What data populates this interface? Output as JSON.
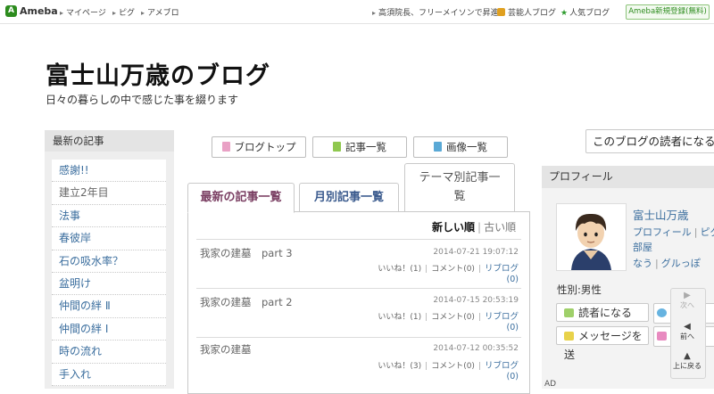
{
  "topbar": {
    "logo": "Ameba",
    "links": [
      "マイページ",
      "ピグ",
      "アメブロ"
    ],
    "news": "高須院長、フリーメイソンで昇進",
    "geinou": "芸能人ブログ",
    "ninki": "人気ブログ",
    "register": "Ameba新規登録(無料)"
  },
  "blog": {
    "title": "富士山万歳のブログ",
    "description": "日々の暮らしの中で感じた事を綴ります"
  },
  "sidebar": {
    "heading": "最新の記事",
    "items": [
      {
        "label": "感謝!!"
      },
      {
        "label": "建立2年目"
      },
      {
        "label": "法事"
      },
      {
        "label": "春彼岸"
      },
      {
        "label": "石の吸水率？"
      },
      {
        "label": "盆明け"
      },
      {
        "label": "仲間の絆 Ⅱ"
      },
      {
        "label": "仲間の絆 Ⅰ"
      },
      {
        "label": "時の流れ"
      },
      {
        "label": "手入れ"
      }
    ]
  },
  "nav": {
    "blog_top": "ブログトップ",
    "entry_list": "記事一覧",
    "image_list": "画像一覧"
  },
  "tabs": {
    "latest": "最新の記事一覧",
    "monthly": "月別記事一覧",
    "theme_line1": "テーマ別記事一",
    "theme_line2": "覧"
  },
  "sort": {
    "newest": "新しい順",
    "oldest": "古い順"
  },
  "entries": [
    {
      "title": "我家の建墓　part 3",
      "date": "2014-07-21 19:07:12",
      "likes": "いいね！(1)",
      "comments": "コメント(0)",
      "reblog": "リブログ",
      "reblog_count": "(0)"
    },
    {
      "title": "我家の建墓　part 2",
      "date": "2014-07-15 20:53:19",
      "likes": "いいね！(1)",
      "comments": "コメント(0)",
      "reblog": "リブログ",
      "reblog_count": "(0)"
    },
    {
      "title": "我家の建墓",
      "date": "2014-07-12 00:35:52",
      "likes": "いいね！(3)",
      "comments": "コメント(0)",
      "reblog": "リブログ",
      "reblog_count": "(0)"
    }
  ],
  "reader_box": "このブログの読者になる",
  "profile": {
    "heading": "プロフィール",
    "name": "富士山万歳",
    "link_profile": "プロフィール",
    "link_pigg": "ピグ",
    "room": "部屋",
    "now": "なう",
    "gurupp": "グルっぽ",
    "gender": "性別:男性",
    "reader_button": "読者になる",
    "message_button": "メッセージを送"
  },
  "float_nav": {
    "next": "次へ",
    "prev": "前へ",
    "top": "上に戻る"
  },
  "ad": "AD",
  "colors": {
    "link": "#3b6e9e",
    "ameba_green": "#2d8c1e",
    "active_tab": "#7a3e62"
  }
}
